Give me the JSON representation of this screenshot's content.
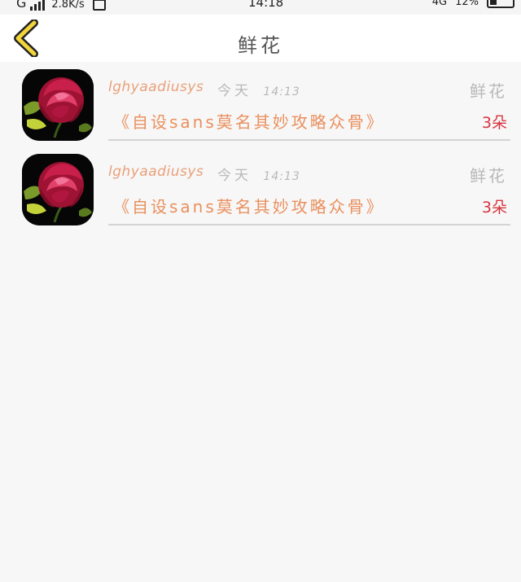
{
  "status_bar": {
    "carrier": "G",
    "speed": "2.8K/s",
    "time": "14:18",
    "network": "4G",
    "battery_pct": "12%"
  },
  "nav": {
    "title": "鲜花",
    "back_icon": "chevron-left-icon",
    "accent": "#f2d53c"
  },
  "records": [
    {
      "username": "lghyaadiusys",
      "date": "今天",
      "time": "14:13",
      "gift_type": "鲜花",
      "message": "《自设sans莫名其妙攻略众骨》",
      "count": "3朵",
      "avatar_icon": "rose-avatar-icon"
    },
    {
      "username": "lghyaadiusys",
      "date": "今天",
      "time": "14:13",
      "gift_type": "鲜花",
      "message": "《自设sans莫名其妙攻略众骨》",
      "count": "3朵",
      "avatar_icon": "rose-avatar-icon"
    }
  ],
  "colors": {
    "username": "#e9a07a",
    "message": "#e9905e",
    "count": "#d8343e",
    "muted": "#b8b8b8"
  }
}
